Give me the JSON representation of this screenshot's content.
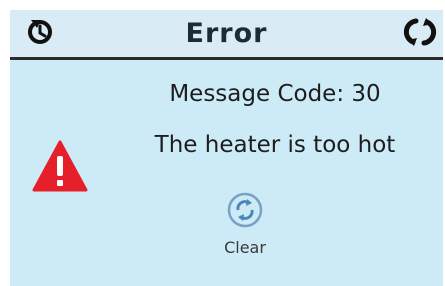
{
  "header": {
    "title": "Error",
    "left_icon": "restart-icon",
    "right_icon": "cycle-icon"
  },
  "message": {
    "code_label": "Message Code: 30",
    "text": "The heater is too hot",
    "warning_icon": "warning-triangle-icon"
  },
  "clear_button": {
    "label": "Clear",
    "icon": "clear-cycle-icon"
  },
  "colors": {
    "header_bg": "#d9ecf5",
    "content_bg": "#ccebf7",
    "warning_red": "#e5202a",
    "clear_icon_blue": "#4a86b8"
  }
}
